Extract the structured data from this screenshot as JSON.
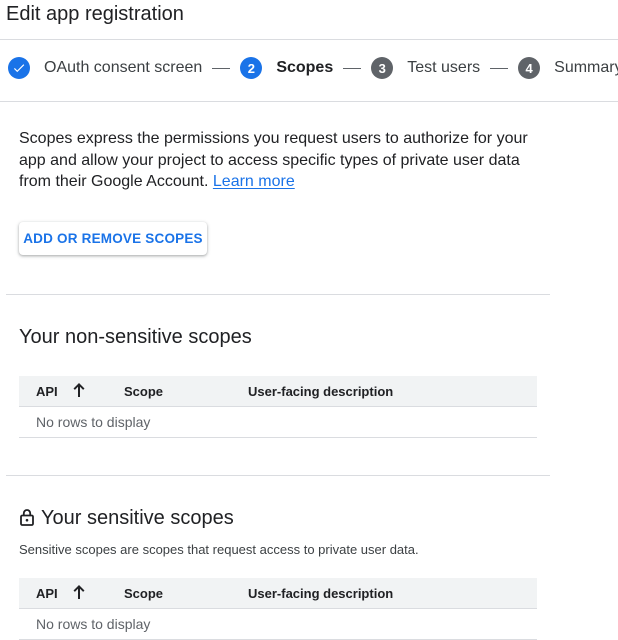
{
  "page": {
    "title": "Edit app registration"
  },
  "stepper": {
    "steps": [
      {
        "number": "",
        "label": "OAuth consent screen",
        "state": "done"
      },
      {
        "number": "2",
        "label": "Scopes",
        "state": "current"
      },
      {
        "number": "3",
        "label": "Test users",
        "state": "future"
      },
      {
        "number": "4",
        "label": "Summary",
        "state": "future"
      }
    ]
  },
  "intro": {
    "text": "Scopes express the permissions you request users to authorize for your app and allow your project to access specific types of private user data from their Google Account.",
    "link": "Learn more"
  },
  "actions": {
    "add_remove_scopes": "ADD OR REMOVE SCOPES"
  },
  "non_sensitive": {
    "title": "Your non-sensitive scopes",
    "columns": {
      "api": "API",
      "scope": "Scope",
      "description": "User-facing description"
    },
    "empty": "No rows to display"
  },
  "sensitive": {
    "title": "Your sensitive scopes",
    "description": "Sensitive scopes are scopes that request access to private user data.",
    "columns": {
      "api": "API",
      "scope": "Scope",
      "description": "User-facing description"
    },
    "empty": "No rows to display"
  },
  "icons": {
    "done_step": "check-icon",
    "sort": "arrow-up-icon",
    "sensitive": "lock-icon"
  },
  "colors": {
    "accent": "#1a73e8",
    "future_step": "#5f6368",
    "table_header": "#f1f3f4"
  }
}
